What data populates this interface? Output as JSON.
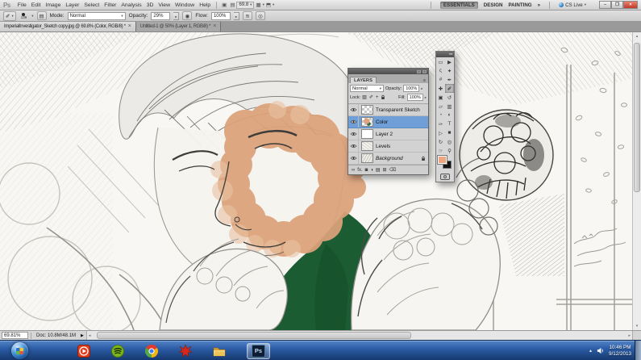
{
  "app": {
    "logo": "Ps",
    "menus": [
      "File",
      "Edit",
      "Image",
      "Layer",
      "Select",
      "Filter",
      "Analysis",
      "3D",
      "View",
      "Window",
      "Help"
    ],
    "zoom_level": "69.8",
    "workspaces": [
      "ESSENTIALS",
      "DESIGN",
      "PAINTING"
    ],
    "workspace_overflow": "»",
    "cs_live_label": "CS Live",
    "window_buttons": {
      "minimize": "–",
      "restore": "❐",
      "close": "×"
    }
  },
  "options_bar": {
    "brush_size": "139",
    "mode_label": "Mode:",
    "mode_value": "Normal",
    "opacity_label": "Opacity:",
    "opacity_value": "29%",
    "flow_label": "Flow:",
    "flow_value": "100%"
  },
  "tabs": [
    {
      "title": "ImperialInvestigator_Sketch copy.jpg @ 69.8% (Color, RGB/8) *",
      "close": "×"
    },
    {
      "title": "Untitled-1 @ 50% (Layer 1, RGB/8) *",
      "close": "×"
    }
  ],
  "icons": {
    "dropdown_arrow": "▾",
    "spinner_arrow": "▸",
    "launch_bridge": "▣",
    "view_extras": "▤",
    "arrange_documents": "▦",
    "screen_mode": "⬒",
    "brush_tool_small": "✐",
    "brush_panel_toggle": "▤",
    "pressure_opacity": "◉",
    "airbrush": "≋",
    "pressure_size": "◎",
    "panel_collapse": "◂◂",
    "panel_menu": "≡",
    "scroll_up": "▴",
    "scroll_down": "▾",
    "scroll_left": "◂",
    "scroll_right": "▸",
    "status_popup": "▶",
    "tray_hidden": "▴"
  },
  "tools": [
    {
      "name": "rectangular-marquee-tool",
      "glyph": "▭"
    },
    {
      "name": "move-tool",
      "glyph": "▶"
    },
    {
      "name": "lasso-tool",
      "glyph": "ς"
    },
    {
      "name": "quick-selection-tool",
      "glyph": "✦"
    },
    {
      "name": "crop-tool",
      "glyph": "#"
    },
    {
      "name": "eyedropper-tool",
      "glyph": "✒"
    },
    {
      "name": "spot-healing-brush-tool",
      "glyph": "✚"
    },
    {
      "name": "brush-tool",
      "glyph": "✐"
    },
    {
      "name": "clone-stamp-tool",
      "glyph": "▣"
    },
    {
      "name": "history-brush-tool",
      "glyph": "↺"
    },
    {
      "name": "eraser-tool",
      "glyph": "▱"
    },
    {
      "name": "gradient-tool",
      "glyph": "▥"
    },
    {
      "name": "blur-tool",
      "glyph": "◔"
    },
    {
      "name": "dodge-tool",
      "glyph": "◐"
    },
    {
      "name": "pen-tool",
      "glyph": "✑"
    },
    {
      "name": "type-tool",
      "glyph": "T"
    },
    {
      "name": "path-selection-tool",
      "glyph": "▷"
    },
    {
      "name": "shape-tool",
      "glyph": "■"
    },
    {
      "name": "3d-rotate-tool",
      "glyph": "↻"
    },
    {
      "name": "3d-camera-tool",
      "glyph": "◎"
    },
    {
      "name": "hand-tool",
      "glyph": "☞"
    },
    {
      "name": "zoom-tool",
      "glyph": "⚲"
    }
  ],
  "layers_panel": {
    "title": "LAYERS",
    "blend_mode": "Normal",
    "opacity_label": "Opacity:",
    "opacity_value": "100%",
    "lock_label": "Lock:",
    "fill_label": "Fill:",
    "fill_value": "100%",
    "lock_icons": [
      {
        "name": "lock-transparency-icon",
        "glyph": "▨"
      },
      {
        "name": "lock-paint-icon",
        "glyph": "✐"
      },
      {
        "name": "lock-position-icon",
        "glyph": "+"
      }
    ],
    "layers": [
      {
        "name": "Transparent Sketch"
      },
      {
        "name": "Color"
      },
      {
        "name": "Layer 2"
      },
      {
        "name": "Levels"
      },
      {
        "name": "Background"
      }
    ],
    "bottom_icons": [
      {
        "name": "link-layers-icon",
        "glyph": "∞"
      },
      {
        "name": "layer-style-icon",
        "glyph": "fx."
      },
      {
        "name": "add-layer-mask-icon",
        "glyph": "◙"
      },
      {
        "name": "new-adjustment-layer-icon",
        "glyph": "◑"
      },
      {
        "name": "new-group-icon",
        "glyph": "▤"
      },
      {
        "name": "new-layer-icon",
        "glyph": "⊞"
      },
      {
        "name": "delete-layer-icon",
        "glyph": "⌫"
      }
    ]
  },
  "status_bar": {
    "zoom": "69.81%",
    "doc_info": "Doc: 10.8M/48.1M"
  },
  "tray": {
    "time": "10:46 PM",
    "date": "9/12/2013"
  },
  "colors": {
    "foreground_swatch": "#efa67f",
    "background_swatch": "#141414",
    "selected_layer_blue": "#6f9fd6",
    "skin_paint": "#dca27a",
    "green_paint": "#1b5c33",
    "taskbar_blue": "#2c5da7"
  }
}
